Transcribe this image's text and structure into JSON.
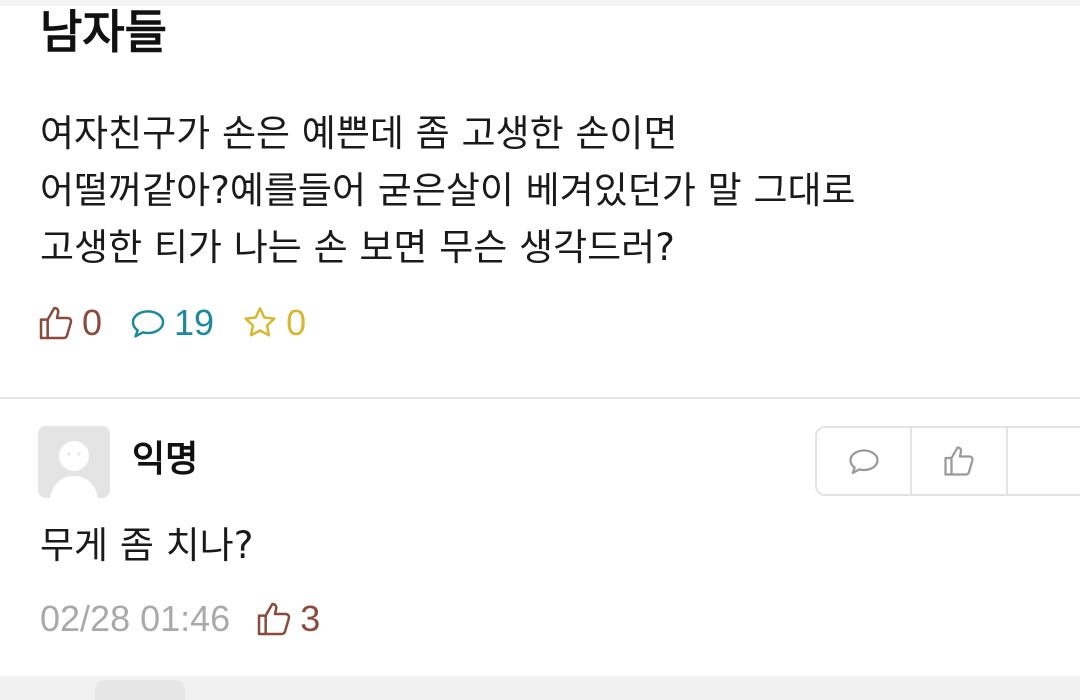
{
  "post": {
    "board_title": "남자들",
    "body_lines": [
      "여자친구가 손은 예쁜데 좀 고생한 손이면",
      "어떨꺼같아?예를들어 굳은살이 베겨있던가 말 그대로",
      "고생한 티가 나는 손 보면 무슨 생각드러?"
    ],
    "stats": {
      "likes": "0",
      "comments": "19",
      "scraps": "0"
    },
    "icons": {
      "like": "thumbs-up-icon",
      "comment": "speech-bubble-icon",
      "scrap": "star-icon"
    },
    "colors": {
      "like": "#8a4b3c",
      "comment": "#1c8a9c",
      "scrap": "#d8b832"
    }
  },
  "comment": {
    "author": "익명",
    "text": "무게 좀 치나?",
    "timestamp": "02/28 01:46",
    "likes": "3",
    "avatar_icon": "anonymous-avatar-icon",
    "action_icons": [
      "reply-icon",
      "thumbs-up-icon"
    ]
  }
}
